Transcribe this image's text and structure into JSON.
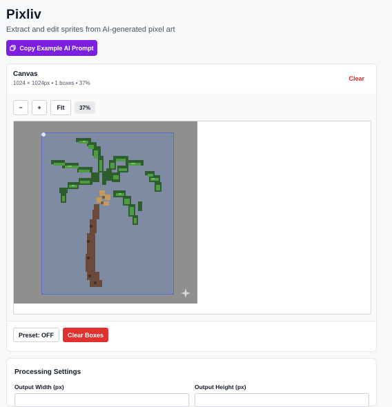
{
  "app": {
    "title": "Pixliv",
    "subtitle": "Extract and edit sprites from AI-generated pixel art",
    "copy_prompt_label": "Copy Example AI Prompt"
  },
  "canvas": {
    "title": "Canvas",
    "meta": "1024 × 1024px • 1 boxes • 37%",
    "clear_label": "Clear",
    "toolbar": {
      "zoom_out_label": "−",
      "zoom_in_label": "+",
      "fit_label": "Fit",
      "zoom_level": "37%"
    },
    "preset_label": "Preset: OFF",
    "clear_boxes_label": "Clear Boxes"
  },
  "processing": {
    "title": "Processing Settings",
    "output_width_label": "Output Width (px)",
    "output_height_label": "Output Height (px)"
  },
  "colors": {
    "accent_purple": "#7c1fe0",
    "danger_red": "#e0302f",
    "sprite_box_border": "#5b6bc9",
    "canvas_bg": "#8f8f8f",
    "sprite_bg": "#7f8ba2"
  },
  "icons": {
    "copy": "copy-icon",
    "sparkle": "sparkle-icon"
  }
}
